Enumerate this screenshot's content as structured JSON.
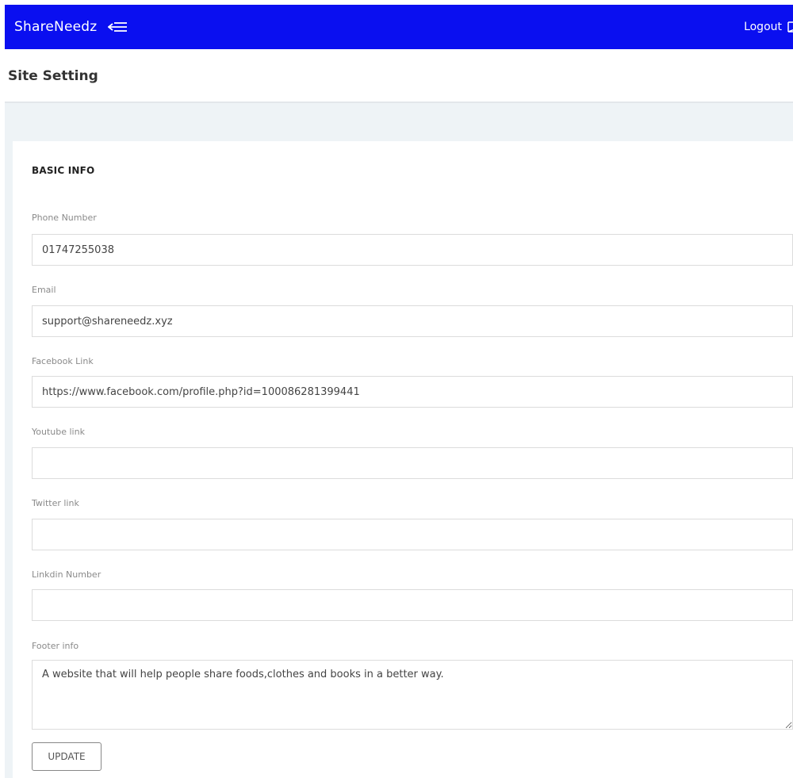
{
  "header": {
    "brand": "ShareNeedz",
    "logout_label": "Logout",
    "bar_color": "#0a0ff0",
    "menu_icon": "menu-toggle-icon",
    "logout_icon": "logout-icon"
  },
  "page": {
    "title": "Site Setting"
  },
  "form": {
    "section_title": "BASIC INFO",
    "phone": {
      "label": "Phone Number",
      "value": "01747255038"
    },
    "email": {
      "label": "Email",
      "value": "support@shareneedz.xyz"
    },
    "facebook": {
      "label": "Facebook Link",
      "value": "https://www.facebook.com/profile.php?id=100086281399441"
    },
    "youtube": {
      "label": "Youtube link",
      "value": ""
    },
    "twitter": {
      "label": "Twitter link",
      "value": ""
    },
    "linkedin": {
      "label": "Linkdin Number",
      "value": ""
    },
    "footer": {
      "label": "Footer info",
      "value": "A website that will help people share foods,clothes and books in a better way."
    },
    "update_label": "UPDATE"
  }
}
